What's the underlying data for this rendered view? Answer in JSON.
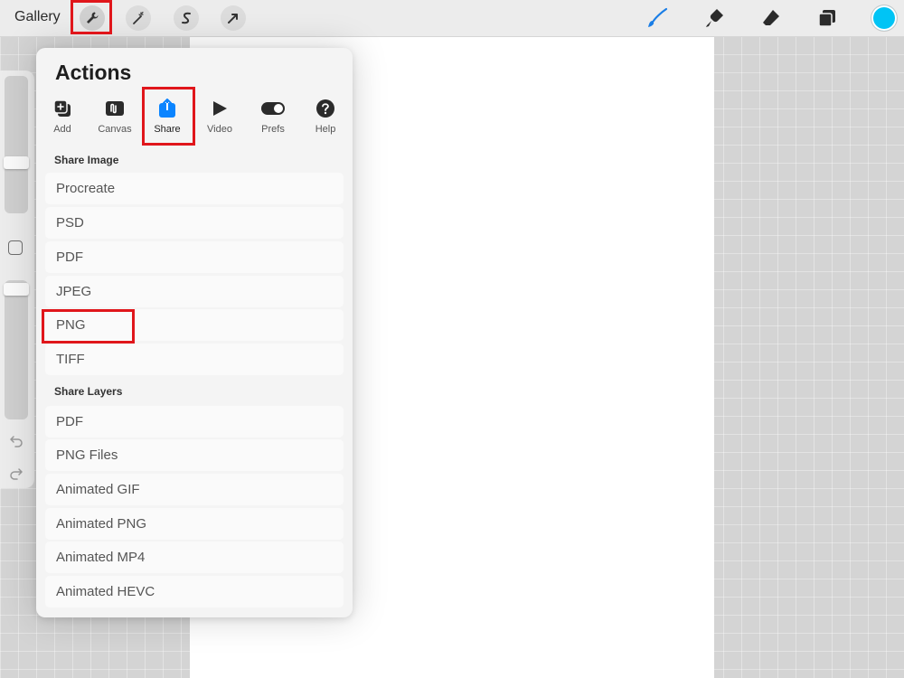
{
  "topbar": {
    "gallery_label": "Gallery",
    "tools": [
      {
        "name": "wrench-icon"
      },
      {
        "name": "magic-wand-icon"
      },
      {
        "name": "s-curve-icon"
      },
      {
        "name": "arrow-cursor-icon"
      }
    ],
    "right_tools": [
      "brush-icon",
      "smudge-icon",
      "eraser-icon",
      "layers-icon"
    ],
    "active_color": "#00c4f5"
  },
  "actions": {
    "title": "Actions",
    "tabs": [
      {
        "label": "Add",
        "icon": "add-icon"
      },
      {
        "label": "Canvas",
        "icon": "canvas-icon"
      },
      {
        "label": "Share",
        "icon": "share-icon",
        "active": true
      },
      {
        "label": "Video",
        "icon": "video-icon"
      },
      {
        "label": "Prefs",
        "icon": "prefs-toggle-icon"
      },
      {
        "label": "Help",
        "icon": "help-icon"
      }
    ],
    "share_image_header": "Share Image",
    "share_image_items": [
      "Procreate",
      "PSD",
      "PDF",
      "JPEG",
      "PNG",
      "TIFF"
    ],
    "share_layers_header": "Share Layers",
    "share_layers_items": [
      "PDF",
      "PNG Files",
      "Animated GIF",
      "Animated PNG",
      "Animated MP4",
      "Animated HEVC"
    ]
  },
  "colors": {
    "accent_blue": "#0a84ff",
    "highlight_red": "#e0161b"
  }
}
